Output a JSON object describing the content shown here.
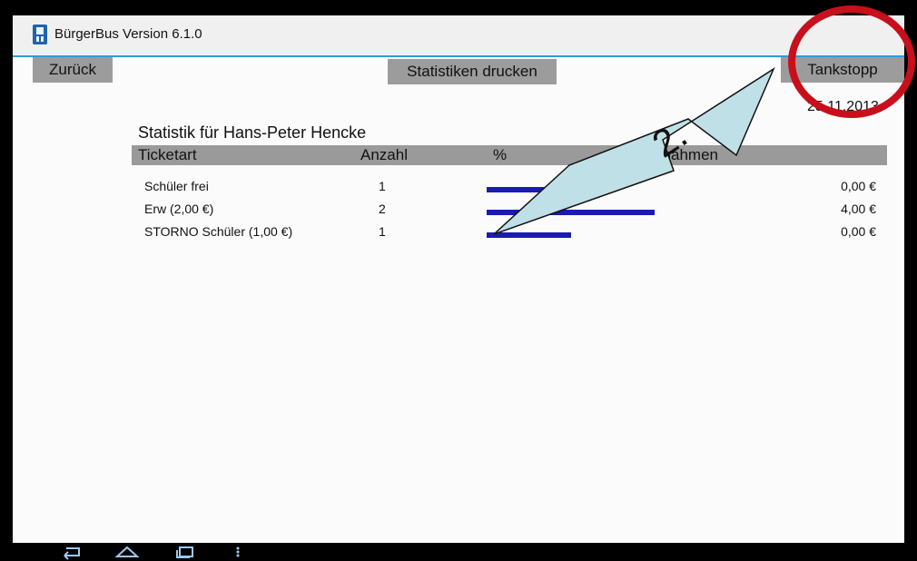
{
  "app": {
    "title": "BürgerBus Version 6.1.0",
    "icon": "bus-app-icon"
  },
  "toolbar": {
    "back_label": "Zurück",
    "print_label": "Statistiken drucken",
    "tank_label": "Tankstopp",
    "date": "25.11.2013"
  },
  "stats": {
    "title": "Statistik für Hans-Peter Hencke",
    "headers": [
      "Ticketart",
      "Anzahl",
      "%",
      "Einnahmen"
    ],
    "rows": [
      {
        "ticket": "Schüler frei",
        "count": "1",
        "percent": 25,
        "amount": "0,00 €"
      },
      {
        "ticket": "Erw (2,00 €)",
        "count": "2",
        "percent": 50,
        "amount": "4,00 €"
      },
      {
        "ticket": "STORNO  Schüler (1,00 €)",
        "count": "1",
        "percent": 25,
        "amount": "0,00 €"
      }
    ]
  },
  "annotation": {
    "step_label": "2.",
    "circle_color": "#c8101c",
    "arrow_color": "#bfe0e6"
  },
  "colors": {
    "accent": "#2b9ed8",
    "button_bg": "#9c9c9c",
    "bar": "#1b1bb3"
  },
  "nav_icons": [
    "back-icon",
    "home-icon",
    "recent-apps-icon",
    "menu-icon"
  ]
}
